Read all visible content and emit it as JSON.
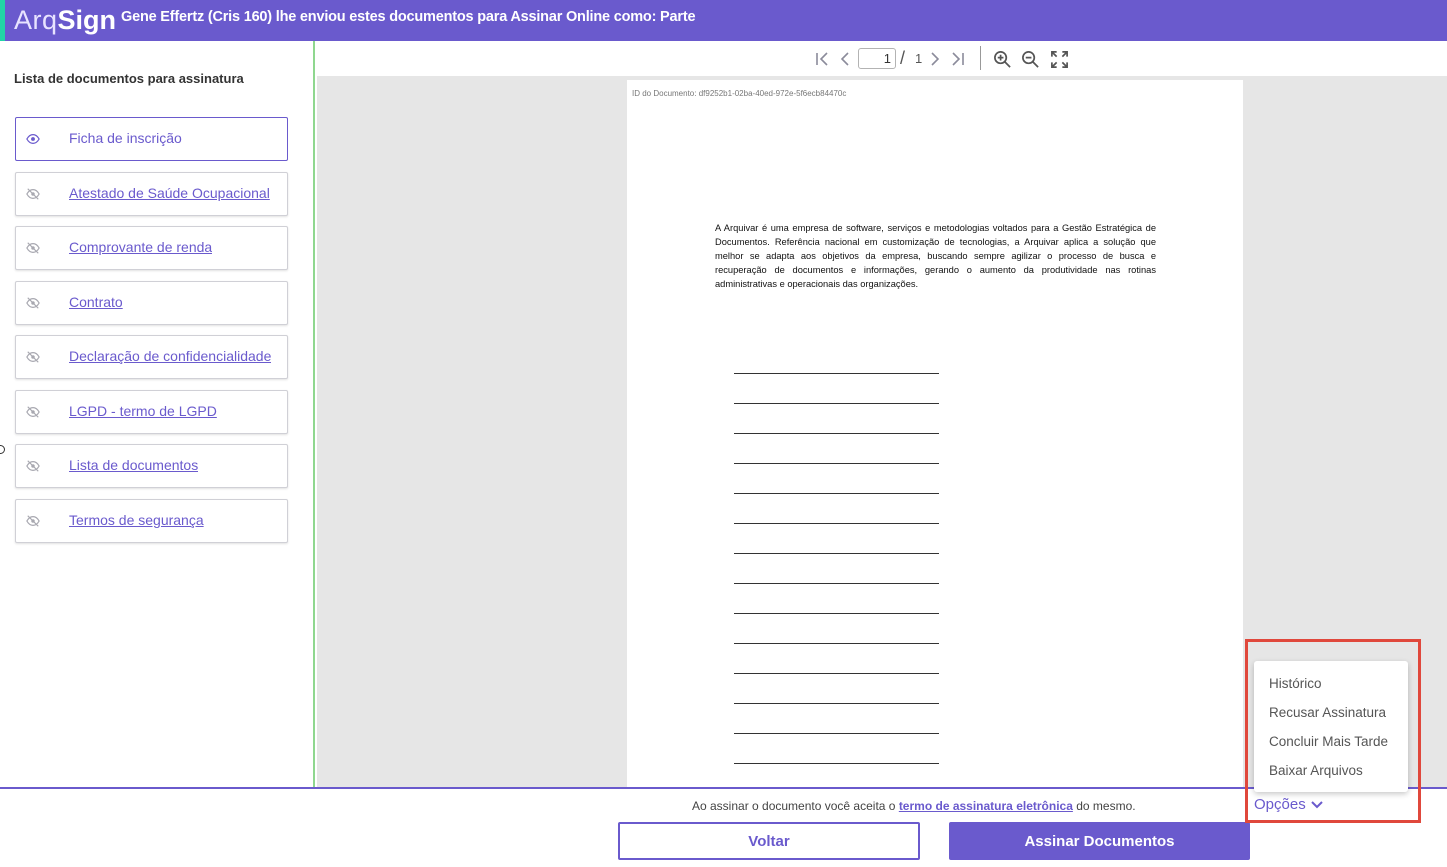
{
  "header": {
    "logo_part1": "Arq",
    "logo_part2": "Sign",
    "title": "Gene Effertz (Cris 160) lhe enviou estes documentos para Assinar Online como: Parte"
  },
  "toolbar": {
    "current_page": "1",
    "separator": "/",
    "total_pages": "1",
    "icons": [
      "first-page-icon",
      "previous-page-icon",
      "next-page-icon",
      "last-page-icon",
      "zoom-in-icon",
      "zoom-out-icon",
      "fullscreen-icon"
    ]
  },
  "sidebar": {
    "title": "Lista de documentos para assinatura",
    "items": [
      {
        "label": "Ficha de inscrição",
        "active": true,
        "icon": "eye-icon"
      },
      {
        "label": "Atestado de Saúde Ocupacional",
        "active": false,
        "icon": "eye-off-icon"
      },
      {
        "label": "Comprovante de renda",
        "active": false,
        "icon": "eye-off-icon"
      },
      {
        "label": "Contrato",
        "active": false,
        "icon": "eye-off-icon"
      },
      {
        "label": "Declaração de confidencialidade",
        "active": false,
        "icon": "eye-off-icon"
      },
      {
        "label": "LGPD - termo de LGPD",
        "active": false,
        "icon": "eye-off-icon"
      },
      {
        "label": "Lista de documentos",
        "active": false,
        "icon": "eye-off-icon"
      },
      {
        "label": "Termos de segurança",
        "active": false,
        "icon": "eye-off-icon"
      }
    ]
  },
  "document": {
    "id_text": "ID do Documento: df9252b1-02ba-40ed-972e-5f6ecb84470c",
    "body": "A Arquivar é uma empresa de software, serviços e metodologias voltados para a Gestão Estratégica de Documentos. Referência nacional em customização de tecnologias, a Arquivar aplica a solução que melhor se adapta aos objetivos da empresa, buscando sempre agilizar o processo de busca e recuperação de documentos e informações, gerando o aumento da produtividade nas rotinas administrativas e operacionais das organizações."
  },
  "footer": {
    "terms_prefix": "Ao assinar o documento você aceita o",
    "terms_link": "termo de assinatura eletrônica",
    "terms_suffix": "do mesmo.",
    "back_label": "Voltar",
    "sign_label": "Assinar Documentos"
  },
  "options": {
    "toggle_label": "Opções",
    "menu": [
      "Histórico",
      "Recusar Assinatura",
      "Concluir Mais Tarde",
      "Baixar Arquivos"
    ]
  },
  "colors": {
    "brand": "#6a5acd",
    "highlight": "#e0483c",
    "divider": "#8fd78f"
  }
}
